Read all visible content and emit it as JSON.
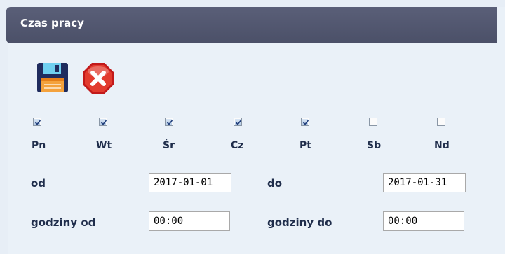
{
  "panel": {
    "title": "Czas pracy"
  },
  "toolbar": {
    "save_icon": "floppy-disk-save-icon",
    "cancel_icon": "red-x-cancel-icon"
  },
  "days": [
    {
      "label": "Pn",
      "checked": true
    },
    {
      "label": "Wt",
      "checked": true
    },
    {
      "label": "Śr",
      "checked": true
    },
    {
      "label": "Cz",
      "checked": true
    },
    {
      "label": "Pt",
      "checked": true
    },
    {
      "label": "Sb",
      "checked": false
    },
    {
      "label": "Nd",
      "checked": false
    }
  ],
  "dates": {
    "from_label": "od",
    "from_value": "2017-01-01",
    "to_label": "do",
    "to_value": "2017-01-31"
  },
  "hours": {
    "from_label": "godziny od",
    "from_value": "00:00",
    "to_label": "godziny do",
    "to_value": "00:00"
  },
  "colors": {
    "titlebar": "#4f546c",
    "label_text": "#1f2d4b",
    "background": "#eaf1f8",
    "cancel_red": "#d9241b"
  }
}
